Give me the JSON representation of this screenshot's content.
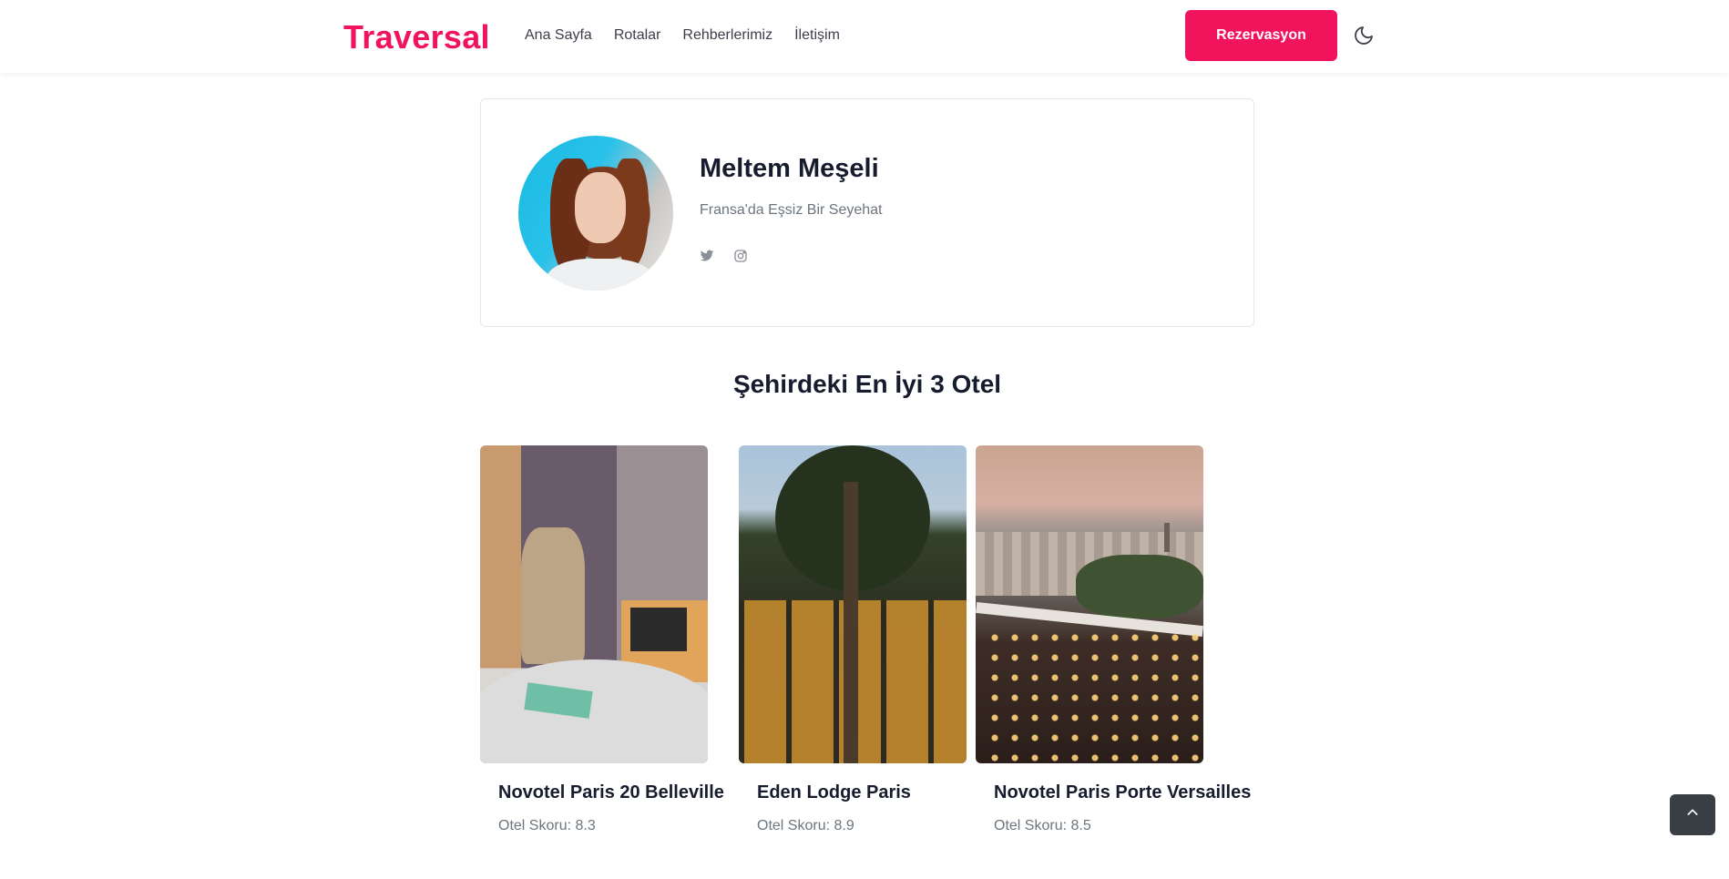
{
  "header": {
    "brand": "Traversal",
    "nav": [
      "Ana Sayfa",
      "Rotalar",
      "Rehberlerimiz",
      "İletişim"
    ],
    "cta_label": "Rezervasyon",
    "theme_icon": "moon-icon",
    "brand_color": "#f2135d"
  },
  "profile": {
    "name": "Meltem Meşeli",
    "subtitle": "Fransa'da Eşsiz Bir Seyehat",
    "social_icons": [
      "twitter-icon",
      "instagram-icon"
    ]
  },
  "hotels_section": {
    "title": "Şehirdeki En İyi 3 Otel",
    "hotels": [
      {
        "name": "Novotel Paris 20 Belleville",
        "score": "Otel Skoru: 8.3"
      },
      {
        "name": "Eden Lodge Paris",
        "score": "Otel Skoru: 8.9"
      },
      {
        "name": "Novotel Paris Porte Versailles",
        "score": "Otel Skoru: 8.5"
      }
    ]
  },
  "back_to_top_icon": "chevron-up-icon"
}
